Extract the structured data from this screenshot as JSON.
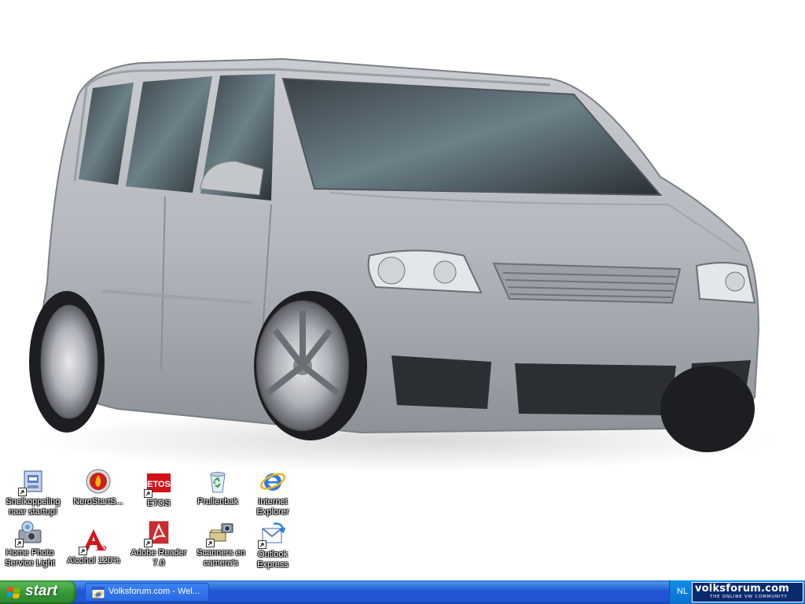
{
  "desktop": {
    "icons": [
      {
        "label": "Snelkoppeling naar startup!",
        "icon": "startup-shortcut-icon"
      },
      {
        "label": "NeroStartS...",
        "icon": "nero-icon"
      },
      {
        "label": "ETOS",
        "icon": "etos-icon"
      },
      {
        "label": "Prullenbak",
        "icon": "recycle-bin-icon"
      },
      {
        "label": "Internet Explorer",
        "icon": "internet-explorer-icon"
      },
      {
        "label": "Home Photo Service Light",
        "icon": "photo-service-icon"
      },
      {
        "label": "Alcohol 120%",
        "icon": "alcohol-icon"
      },
      {
        "label": "Adobe Reader 7.0",
        "icon": "adobe-reader-icon"
      },
      {
        "label": "Scanners en camera's",
        "icon": "scanners-cameras-icon"
      },
      {
        "label": "Outlook Express",
        "icon": "outlook-express-icon"
      }
    ]
  },
  "taskbar": {
    "start_label": "start",
    "window_button": "Volksforum.com - Wel...",
    "language": "NL",
    "tray_logo": {
      "main": "volksforum.com",
      "sub": "THE ONLINE VW COMMUNITY"
    }
  }
}
